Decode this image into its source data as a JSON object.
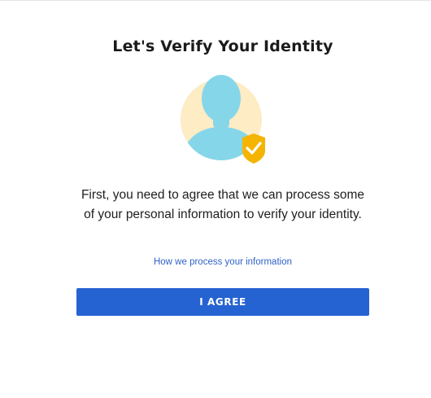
{
  "page": {
    "title": "Let's Verify Your Identity",
    "description": "First, you need to agree that we can process some of your personal information to verify your identity.",
    "link_text": "How we process your information",
    "agree_label": "I AGREE"
  },
  "illustration": {
    "icon": "person-verified-icon",
    "badge_icon": "shield-check-icon",
    "colors": {
      "background_circle": "#fdecc4",
      "person": "#86d6ea",
      "shield": "#f4b400",
      "check": "#ffffff"
    }
  },
  "colors": {
    "accent": "#2563d2",
    "link": "#2f62c8",
    "text": "#1e1e1e"
  }
}
